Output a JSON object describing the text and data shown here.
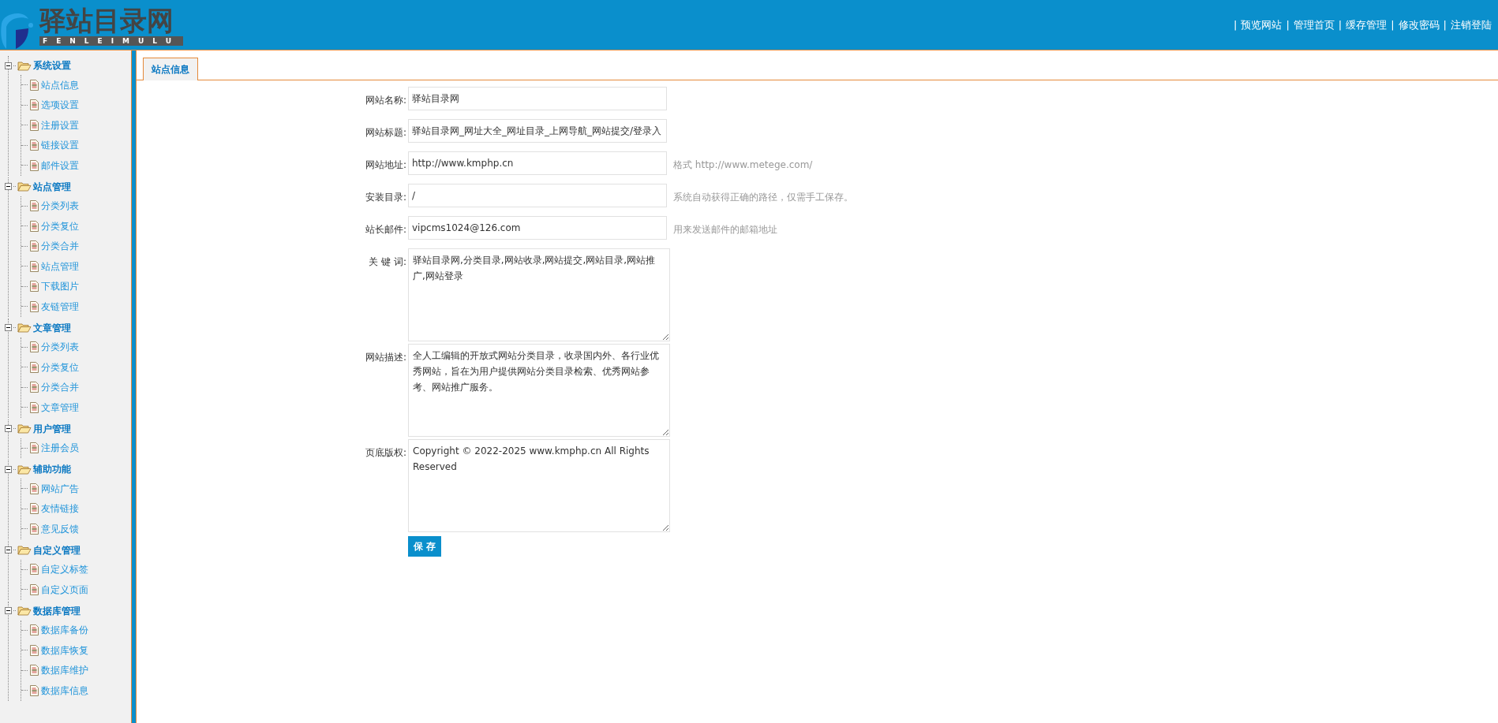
{
  "header": {
    "logo_title": "驿站目录网",
    "logo_subtitle": "FENLEIMULU",
    "separator": "|",
    "links": [
      "预览网站",
      "管理首页",
      "缓存管理",
      "修改密码",
      "注销登陆"
    ]
  },
  "sidebar": {
    "groups": [
      {
        "label": "系统设置",
        "expanded": true,
        "children": [
          "站点信息",
          "选项设置",
          "注册设置",
          "链接设置",
          "邮件设置"
        ]
      },
      {
        "label": "站点管理",
        "expanded": true,
        "children": [
          "分类列表",
          "分类复位",
          "分类合并",
          "站点管理",
          "下载图片",
          "友链管理"
        ]
      },
      {
        "label": "文章管理",
        "expanded": true,
        "children": [
          "分类列表",
          "分类复位",
          "分类合并",
          "文章管理"
        ]
      },
      {
        "label": "用户管理",
        "expanded": true,
        "children": [
          "注册会员"
        ]
      },
      {
        "label": "辅助功能",
        "expanded": true,
        "children": [
          "网站广告",
          "友情链接",
          "意见反馈"
        ]
      },
      {
        "label": "自定义管理",
        "expanded": true,
        "children": [
          "自定义标签",
          "自定义页面"
        ]
      },
      {
        "label": "数据库管理",
        "expanded": true,
        "children": [
          "数据库备份",
          "数据库恢复",
          "数据库维护",
          "数据库信息"
        ]
      }
    ]
  },
  "tabs": [
    {
      "label": "站点信息",
      "selected": true
    }
  ],
  "form": {
    "fields": [
      {
        "kind": "input",
        "label": "网站名称:",
        "value": "驿站目录网"
      },
      {
        "kind": "input",
        "label": "网站标题:",
        "value": "驿站目录网_网址大全_网址目录_上网导航_网站提交/登录入"
      },
      {
        "kind": "input",
        "label": "网站地址:",
        "value": "http://www.kmphp.cn",
        "hint": "格式 http://www.metege.com/"
      },
      {
        "kind": "input",
        "label": "安装目录:",
        "value": "/",
        "hint": "系统自动获得正确的路径，仅需手工保存。"
      },
      {
        "kind": "input",
        "label": "站长邮件:",
        "value": "vipcms1024@126.com",
        "hint": "用来发送邮件的邮箱地址"
      },
      {
        "kind": "textarea",
        "label": "关 键 词:",
        "value": "驿站目录网,分类目录,网站收录,网站提交,网站目录,网站推广,网站登录"
      },
      {
        "kind": "textarea",
        "label": "网站描述:",
        "value": "全人工编辑的开放式网站分类目录，收录国内外、各行业优秀网站，旨在为用户提供网站分类目录检索、优秀网站参考、网站推广服务。"
      },
      {
        "kind": "textarea",
        "label": "页底版权:",
        "value": "Copyright © 2022-2025 www.kmphp.cn All Rights Reserved"
      }
    ],
    "submit": "保 存"
  }
}
